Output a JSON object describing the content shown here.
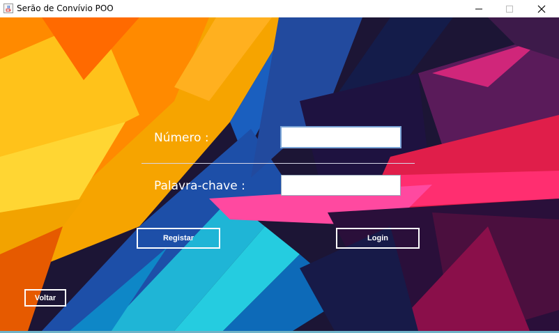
{
  "window": {
    "title": "Serão de Convívio POO",
    "icon": "java-cup-icon",
    "controls": [
      "minimize-icon",
      "maximize-icon",
      "close-icon"
    ]
  },
  "form": {
    "numero_label": "Número :",
    "numero_value": "",
    "password_label": "Palavra-chave :",
    "password_value": ""
  },
  "buttons": {
    "registar": "Registar",
    "login": "Login",
    "voltar": "Voltar"
  },
  "colors": {
    "button_border": "#ffffff",
    "text": "#ffffff",
    "field_focus_border": "#7aa4d6"
  }
}
